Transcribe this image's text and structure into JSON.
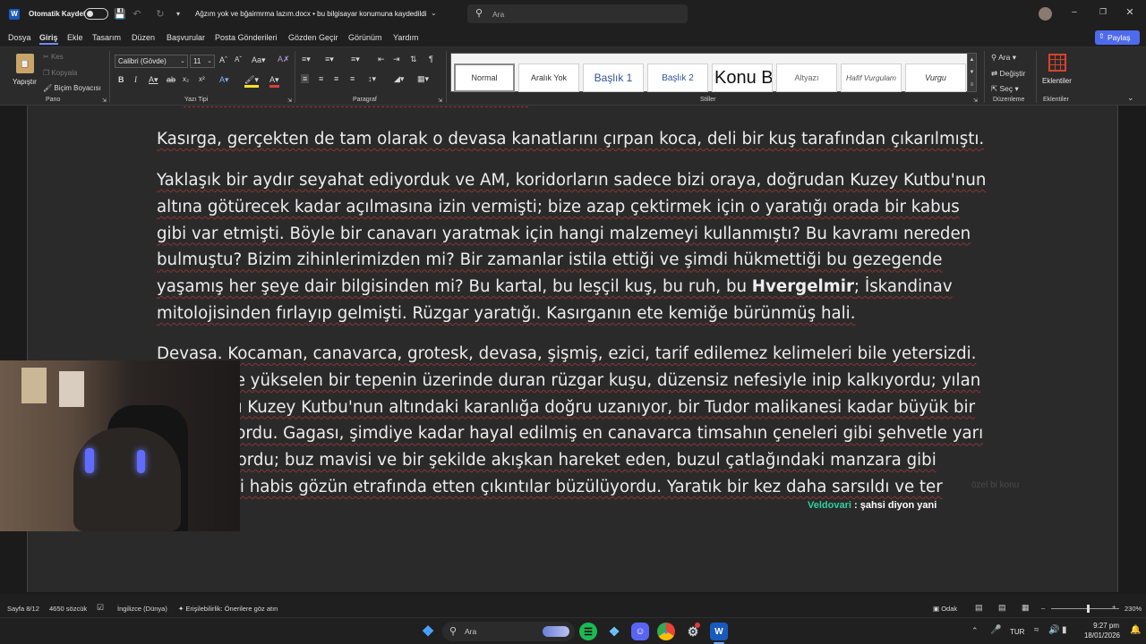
{
  "titlebar": {
    "autosave_label": "Otomatik Kaydet",
    "doc_title": "Ağzım yok  ve bğairmrma lazım.docx  •  bu bilgisayar konumuna kaydedildi",
    "search_placeholder": "Ara"
  },
  "menu": [
    "Dosya",
    "Giriş",
    "Ekle",
    "Tasarım",
    "Düzen",
    "Başvurular",
    "Posta Gönderileri",
    "Gözden Geçir",
    "Görünüm",
    "Yardım"
  ],
  "share_label": "Paylaş",
  "ribbon": {
    "paste_label": "Yapıştır",
    "cut_label": "Kes",
    "copy_label": "Kopyala",
    "format_painter_label": "Biçim Boyacısı",
    "font_name": "Calibri (Gövde)",
    "font_size": "11",
    "groups": {
      "clipboard": "Pano",
      "font": "Yazı Tipi",
      "paragraph": "Paragraf",
      "styles": "Stiller",
      "editing": "Düzenleme",
      "addins": "Eklentiler"
    },
    "styles": [
      "Normal",
      "Aralık Yok",
      "Başlık 1",
      "Başlık 2",
      "Konu B",
      "Altyazı",
      "Hafif Vurgulam",
      "Vurgu"
    ],
    "find_label": "Ara",
    "replace_label": "Değiştir",
    "select_label": "Seç",
    "addins_label": "Eklentiler"
  },
  "document": {
    "p1": "Kasırga, gerçekten de tam olarak o devasa kanatlarını çırpan koca, deli bir kuş tarafından çıkarılmıştı.",
    "p2_before": "Yaklaşık bir aydır seyahat ediyorduk ve AM, koridorların sadece bizi oraya, doğrudan Kuzey Kutbu'nun altına götürecek kadar açılmasına izin vermişti; bize azap çektirmek için o yaratığı orada bir kabus gibi var etmişti. Böyle bir canavarı yaratmak için hangi malzemeyi kullanmıştı? Bu kavramı nereden bulmuştu? Bizim zihinlerimizden mi? Bir zamanlar istila ettiği ve şimdi hükmettiği bu gezegende yaşamış her şeye dair bilgisinden mi? Bu kartal, bu leşçil kuş, bu ruh, bu ",
    "p2_bold": "Hvergelmir",
    "p2_after": "; İskandinav mitolojisinden fırlayıp gelmişti. Rüzgar yaratığı. Kasırganın ete kemiğe bürünmüş hali.",
    "p3": "Devasa. Kocaman, canavarca, grotesk, devasa, şişmiş, ezici, tarif edilemez kelimeleri bile yetersizdi. Önümüzde yükselen bir tepenin üzerinde duran rüzgar kuşu, düzensiz nefesiyle inip kalkıyordu; yılan gibi boynu Kuzey Kutbu'nun altındaki karanlığa doğru uzanıyor, bir Tudor malikanesi kadar büyük bir kafa taşıyordu. Gagası, şimdiye kadar hayal edilmiş en canavarca timsahın çeneleri gibi şehvetle yarı açık açılıyordu; buz mavisi ve bir şekilde akışkan hareket eden, buzul çatlağındaki manzara gibi korkunç iki habis gözün etrafında etten çıkıntılar büzülüyordu. Yaratık bir kez daha sarsıldı ve ter"
  },
  "chat": {
    "username": "Veldovari",
    "separator": " : ",
    "message": "şahsi diyon yani",
    "faded": "özel bi konu"
  },
  "status": {
    "page": "Sayfa 8/12",
    "words": "4650 sözcük",
    "language": "İngilizce (Dünya)",
    "accessibility": "Erişilebilirlik: Önerilere göz atın",
    "focus": "Odak",
    "zoom": "230%"
  },
  "taskbar": {
    "search_label": "Ara",
    "lang": "TUR",
    "time": "9:27 pm",
    "date": "18/01/2026"
  },
  "colors": {
    "accent": "#4f6bed",
    "username": "#2fd1a0",
    "word_blue": "#185abd",
    "addins_red": "#d8432b"
  }
}
